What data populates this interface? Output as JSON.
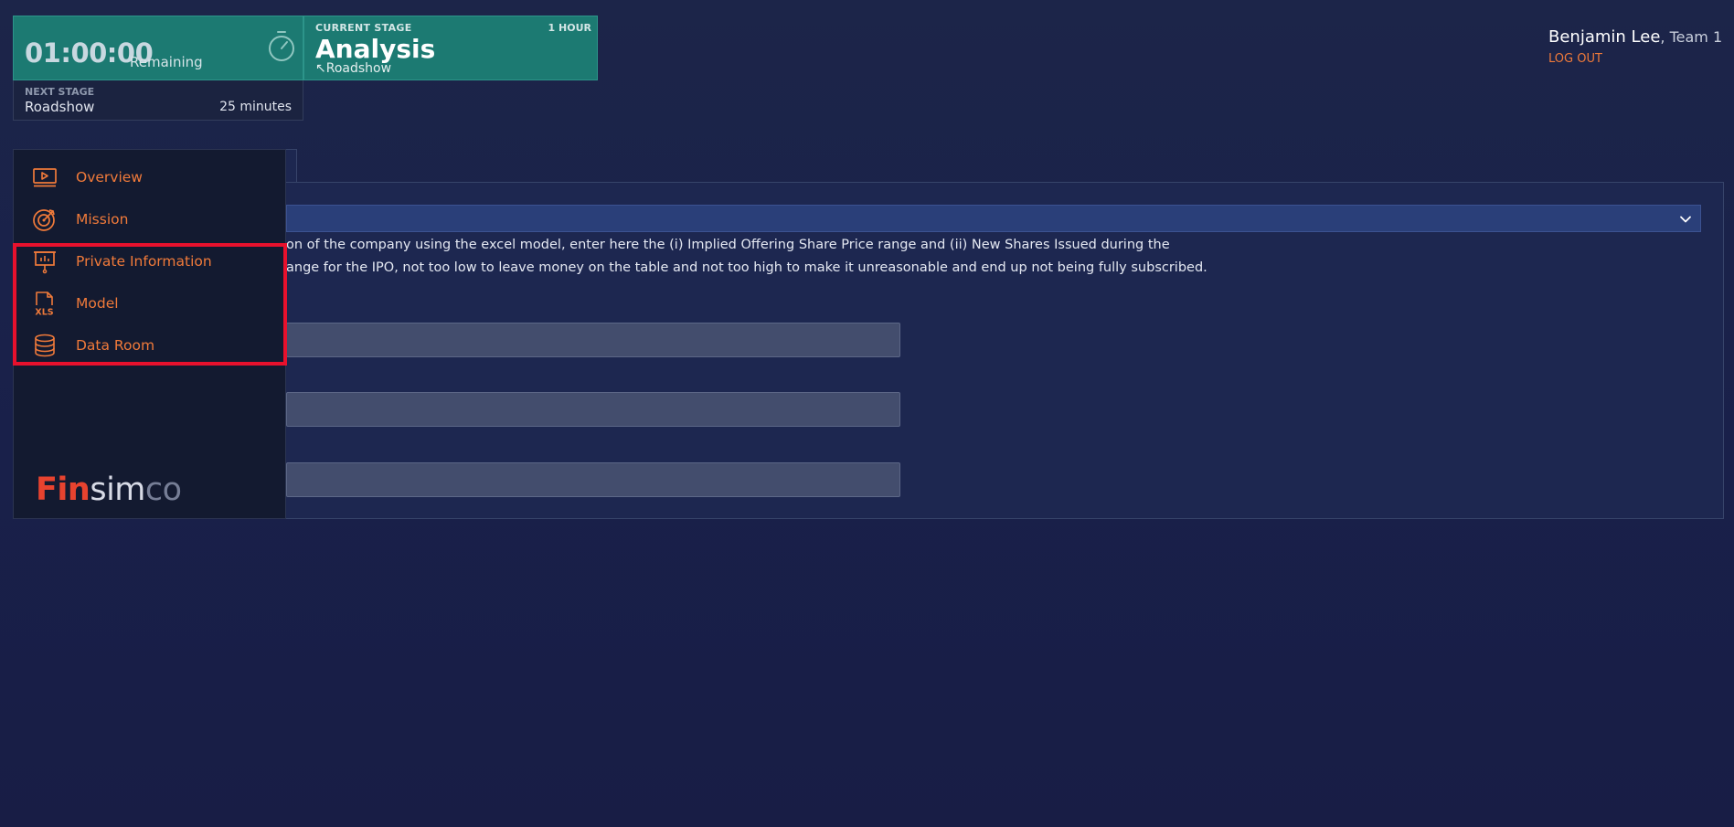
{
  "timer": {
    "value": "01:00:00",
    "remaining_label": "Remaining"
  },
  "current_stage": {
    "label": "CURRENT STAGE",
    "duration": "1 HOUR",
    "title": "Analysis",
    "sub": "↖Roadshow"
  },
  "next_stage": {
    "label": "NEXT STAGE",
    "name": "Roadshow",
    "time": "25 minutes"
  },
  "user": {
    "name": "Benjamin Lee",
    "team": ", Team 1",
    "logout": "LOG OUT"
  },
  "sidebar": {
    "items": [
      {
        "label": "Overview",
        "icon": "play-screen-icon"
      },
      {
        "label": "Mission",
        "icon": "target-icon"
      },
      {
        "label": "Private Information",
        "icon": "presentation-board-icon"
      },
      {
        "label": "Model",
        "icon": "xls-file-icon"
      },
      {
        "label": "Data Room",
        "icon": "database-icon"
      }
    ]
  },
  "logo": {
    "part1": "Fin",
    "part2": "sim",
    "part3": "co"
  },
  "main": {
    "instructions": [
      "on of the company using the excel model, enter here the (i) Implied Offering Share Price range and (ii) New Shares Issued during the",
      "ange for the IPO, not too low to leave money on the table and not too high to make it unreasonable and end up not being fully subscribed."
    ],
    "inputs": [
      {
        "value": "",
        "placeholder": ""
      },
      {
        "value": "",
        "placeholder": ""
      },
      {
        "value": "",
        "placeholder": ""
      }
    ]
  },
  "colors": {
    "accent": "#f07a3a",
    "teal": "#1c7a72",
    "highlight": "#e8112d",
    "background": "#1c2549"
  }
}
